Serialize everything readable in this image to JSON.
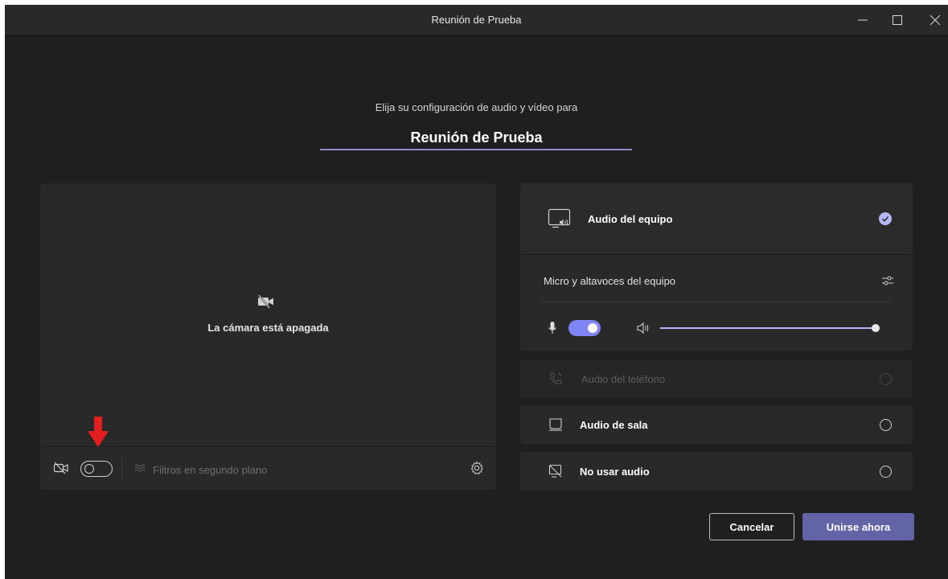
{
  "window": {
    "title": "Reunión de Prueba",
    "controls": [
      "minimize-icon",
      "maximize-icon",
      "close-icon"
    ]
  },
  "header": {
    "subtitle": "Elija su configuración de audio y vídeo para",
    "meeting_name": "Reunión de Prueba"
  },
  "video": {
    "camera_off_text": "La cámara está apagada",
    "camera_toggle_on": false,
    "filters_label": "Filtros en segundo plano"
  },
  "audio": {
    "computer_audio": {
      "label": "Audio del equipo",
      "selected": true
    },
    "device_label": "Micro y altavoces del equipo",
    "mic_toggle_on": true,
    "volume_level": 1.0,
    "phone_audio": {
      "label": "Audio del teléfono",
      "disabled": true
    },
    "room_audio": {
      "label": "Audio de sala"
    },
    "no_audio": {
      "label": "No usar audio"
    }
  },
  "actions": {
    "cancel": "Cancelar",
    "join": "Unirse ahora"
  },
  "colors": {
    "accent": "#6264a7",
    "toggle_on": "#7f85f5",
    "annotation_arrow": "#e31e1e"
  }
}
